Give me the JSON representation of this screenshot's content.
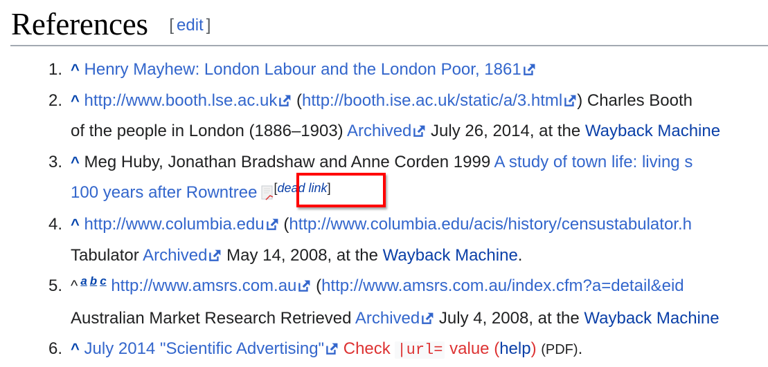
{
  "section": {
    "title": "References",
    "edit_open": "[",
    "edit_label": "edit",
    "edit_close": "]"
  },
  "icons": {
    "external_link": "external-link-icon",
    "broken_file": "broken-file-icon",
    "back_caret": "^"
  },
  "colors": {
    "link": "#3366cc",
    "visited_link": "#0b40a8",
    "error": "#dd3333",
    "highlight": "#ff0000",
    "rule": "#a2a9b1"
  },
  "references": [
    {
      "number": "1.",
      "caret": "^",
      "link1": "Henry Mayhew: London Labour and the London Poor, 1861"
    },
    {
      "number": "2.",
      "caret": "^",
      "link1": "http://www.booth.lse.ac.uk",
      "paren_open": " (",
      "link2": "http://booth.ise.ac.uk/static/a/3.html",
      "text1": ") Charles Booth",
      "line2_text": "of the people in London (1886–1903) ",
      "archived": "Archived",
      "date_text": " July 26, 2014, at the ",
      "wayback": "Wayback Machine"
    },
    {
      "number": "3.",
      "caret": "^",
      "text1": "Meg Huby, Jonathan Bradshaw and Anne Corden 1999 ",
      "link1_part1": "A study of town life: living s",
      "link1_part2": "100 years after Rowntree",
      "dead_open": "[",
      "dead_link": "dead link",
      "dead_close": "]"
    },
    {
      "number": "4.",
      "caret": "^",
      "link1": "http://www.columbia.edu",
      "paren_open": " (",
      "link2": "http://www.columbia.edu/acis/history/censustabulator.h",
      "line2_text": "Tabulator ",
      "archived": "Archived",
      "date_text": " May 14, 2008, at the ",
      "wayback": "Wayback Machine",
      "end": "."
    },
    {
      "number": "5.",
      "caret": "^",
      "backlinks": [
        "a",
        "b",
        "c"
      ],
      "link1": "http://www.amsrs.com.au",
      "paren_open": " (",
      "link2": "http://www.amsrs.com.au/index.cfm?a=detail&eid",
      "line2_text": "Australian Market Research Retrieved ",
      "archived": "Archived",
      "date_text": " July 4, 2008, at the ",
      "wayback": "Wayback Machine"
    },
    {
      "number": "6.",
      "caret": "^",
      "link1": "July 2014 \"Scientific Advertising\"",
      "error_check": "Check ",
      "error_code": "|url=",
      "error_value": " value ",
      "help_open": "(",
      "help_label": "help",
      "help_close": ")",
      "format": "(PDF)",
      "end": "."
    }
  ]
}
